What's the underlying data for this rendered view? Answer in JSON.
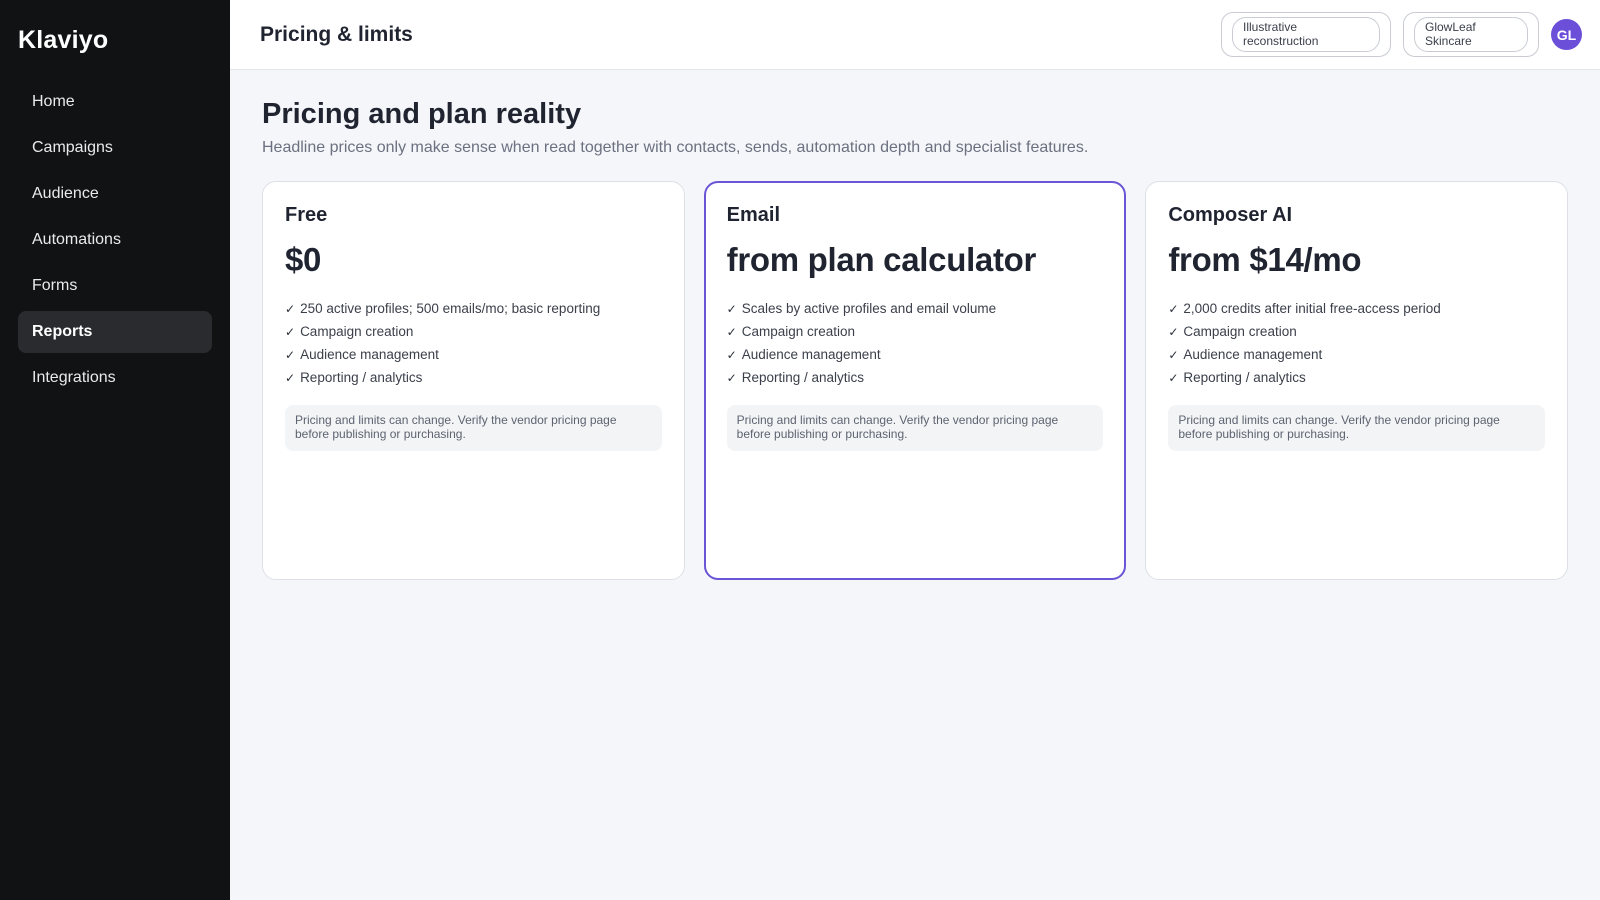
{
  "brand": "Klaviyo",
  "sidebar": {
    "items": [
      {
        "label": "Home"
      },
      {
        "label": "Campaigns"
      },
      {
        "label": "Audience"
      },
      {
        "label": "Automations"
      },
      {
        "label": "Forms"
      },
      {
        "label": "Reports",
        "active": true
      },
      {
        "label": "Integrations"
      }
    ]
  },
  "header": {
    "title": "Pricing & limits",
    "workspace_select": {
      "value": "Illustrative reconstruction"
    },
    "account_select": {
      "value": "GlowLeaf Skincare"
    },
    "avatar_initials": "GL"
  },
  "main": {
    "title": "Pricing and plan reality",
    "subtitle": "Headline prices only make sense when read together with contacts, sends, automation depth and specialist features.",
    "plans": [
      {
        "name": "Free",
        "price": "$0",
        "features": [
          "250 active profiles; 500 emails/mo; basic reporting",
          "Campaign creation",
          "Audience management",
          "Reporting / analytics"
        ],
        "notice": "Pricing and limits can change. Verify the vendor pricing page before publishing or purchasing."
      },
      {
        "name": "Email",
        "price": "from plan calculator",
        "featured": true,
        "features": [
          "Scales by active profiles and email volume",
          "Campaign creation",
          "Audience management",
          "Reporting / analytics"
        ],
        "notice": "Pricing and limits can change. Verify the vendor pricing page before publishing or purchasing."
      },
      {
        "name": "Composer AI",
        "price": "from $14/mo",
        "features": [
          "2,000 credits after initial free-access period",
          "Campaign creation",
          "Audience management",
          "Reporting / analytics"
        ],
        "notice": "Pricing and limits can change. Verify the vendor pricing page before publishing or purchasing."
      }
    ]
  },
  "colors": {
    "sidebar_bg": "#111213",
    "accent": "#6a55d6",
    "avatar_bg": "#6b4fd8"
  },
  "icons": {
    "feature_check": "check-icon"
  }
}
